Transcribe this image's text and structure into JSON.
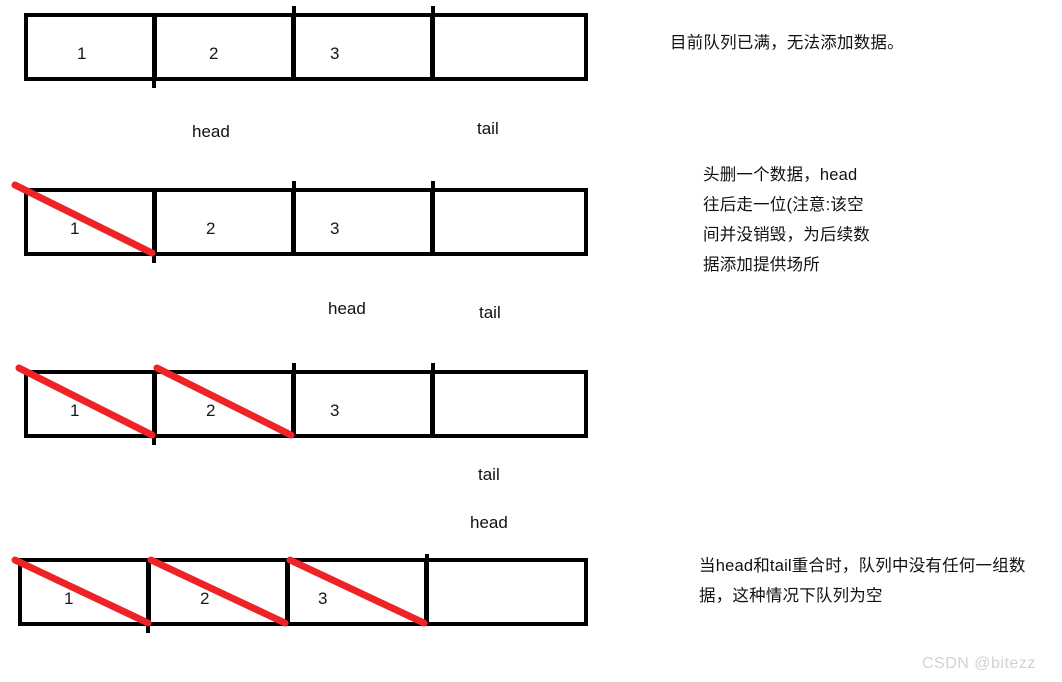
{
  "diagram": {
    "title_hidden": "circular queue head/tail pointer illustration",
    "cell_values": [
      "1",
      "2",
      "3",
      ""
    ],
    "rows": [
      {
        "id": "row-full",
        "cells": [
          "1",
          "2",
          "3",
          ""
        ],
        "struck": 0,
        "head_label": "head",
        "tail_label": "tail"
      },
      {
        "id": "row-one-removed",
        "cells": [
          "1",
          "2",
          "3",
          ""
        ],
        "struck": 1,
        "head_label": "head",
        "tail_label": "tail"
      },
      {
        "id": "row-two-removed",
        "cells": [
          "1",
          "2",
          "3",
          ""
        ],
        "struck": 2,
        "head_label": "head",
        "tail_label": "tail"
      },
      {
        "id": "row-empty",
        "cells": [
          "1",
          "2",
          "3",
          ""
        ],
        "struck": 3,
        "head_label": "",
        "tail_label": ""
      }
    ]
  },
  "notes": {
    "note1": "目前队列已满，无法添加数据。",
    "note2": "头删一个数据，head\n往后走一位(注意:该空\n间并没销毁，为后续数\n据添加提供场所",
    "note3": "当head和tail重合时，队列中没有任何一组数\n据，这种情况下队列为空"
  },
  "watermark": {
    "text": "CSDN @bitezz"
  },
  "colors": {
    "stroke": "#000000",
    "strike": "#ee2326",
    "background": "#ffffff",
    "watermark": "#d2d2d2"
  }
}
